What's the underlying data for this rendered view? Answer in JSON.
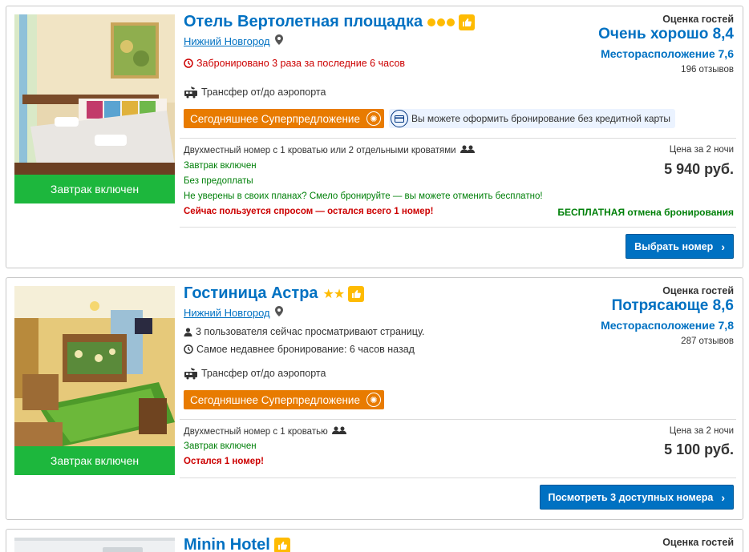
{
  "hotels": [
    {
      "name": "Отель Вертолетная площадка",
      "city": "Нижний Новгород",
      "photo_badge": "Завтрак включен",
      "info1": "Забронировано 3 раза за последние 6 часов",
      "transfer": "Трансфер от/до аэропорта",
      "deal": "Сегодняшнее Суперпредложение",
      "nocard": "Вы можете оформить бронирование без кредитной карты",
      "guest_label": "Оценка гостей",
      "score": "Очень хорошо 8,4",
      "location": "Месторасположение 7,6",
      "reviews": "196 отзывов",
      "room": "Двухместный номер с 1 кроватью или 2 отдельными кроватями",
      "breakfast": "Завтрак включен",
      "noprepay": "Без предоплаты",
      "unsure": "Не уверены в своих планах? Смело бронируйте — вы можете отменить бесплатно!",
      "demand": "Сейчас пользуется спросом — остался всего 1 номер!",
      "price_label": "Цена за 2 ночи",
      "price": "5 940 руб.",
      "free_cancel": "БЕСПЛАТНАЯ отмена бронирования",
      "button": "Выбрать номер"
    },
    {
      "name": "Гостиница Астра",
      "stars": "★★",
      "city": "Нижний Новгород",
      "photo_badge": "Завтрак включен",
      "viewers": "3 пользователя сейчас просматривают страницу.",
      "recent": "Самое недавнее бронирование: 6 часов назад",
      "transfer": "Трансфер от/до аэропорта",
      "deal": "Сегодняшнее Суперпредложение",
      "guest_label": "Оценка гостей",
      "score": "Потрясающе 8,6",
      "location": "Месторасположение 7,8",
      "reviews": "287 отзывов",
      "room": "Двухместный номер с 1 кроватью",
      "breakfast": "Завтрак включен",
      "left": "Остался 1 номер!",
      "price_label": "Цена за 2 ночи",
      "price": "5 100 руб.",
      "button": "Посмотреть 3 доступных номера"
    },
    {
      "name": "Minin Hotel",
      "guest_label": "Оценка гостей"
    }
  ],
  "colors": {
    "link": "#0071c2",
    "deal": "#e87b00",
    "badge": "#1db73d",
    "button": "#0071c2",
    "gold": "#febb02"
  }
}
